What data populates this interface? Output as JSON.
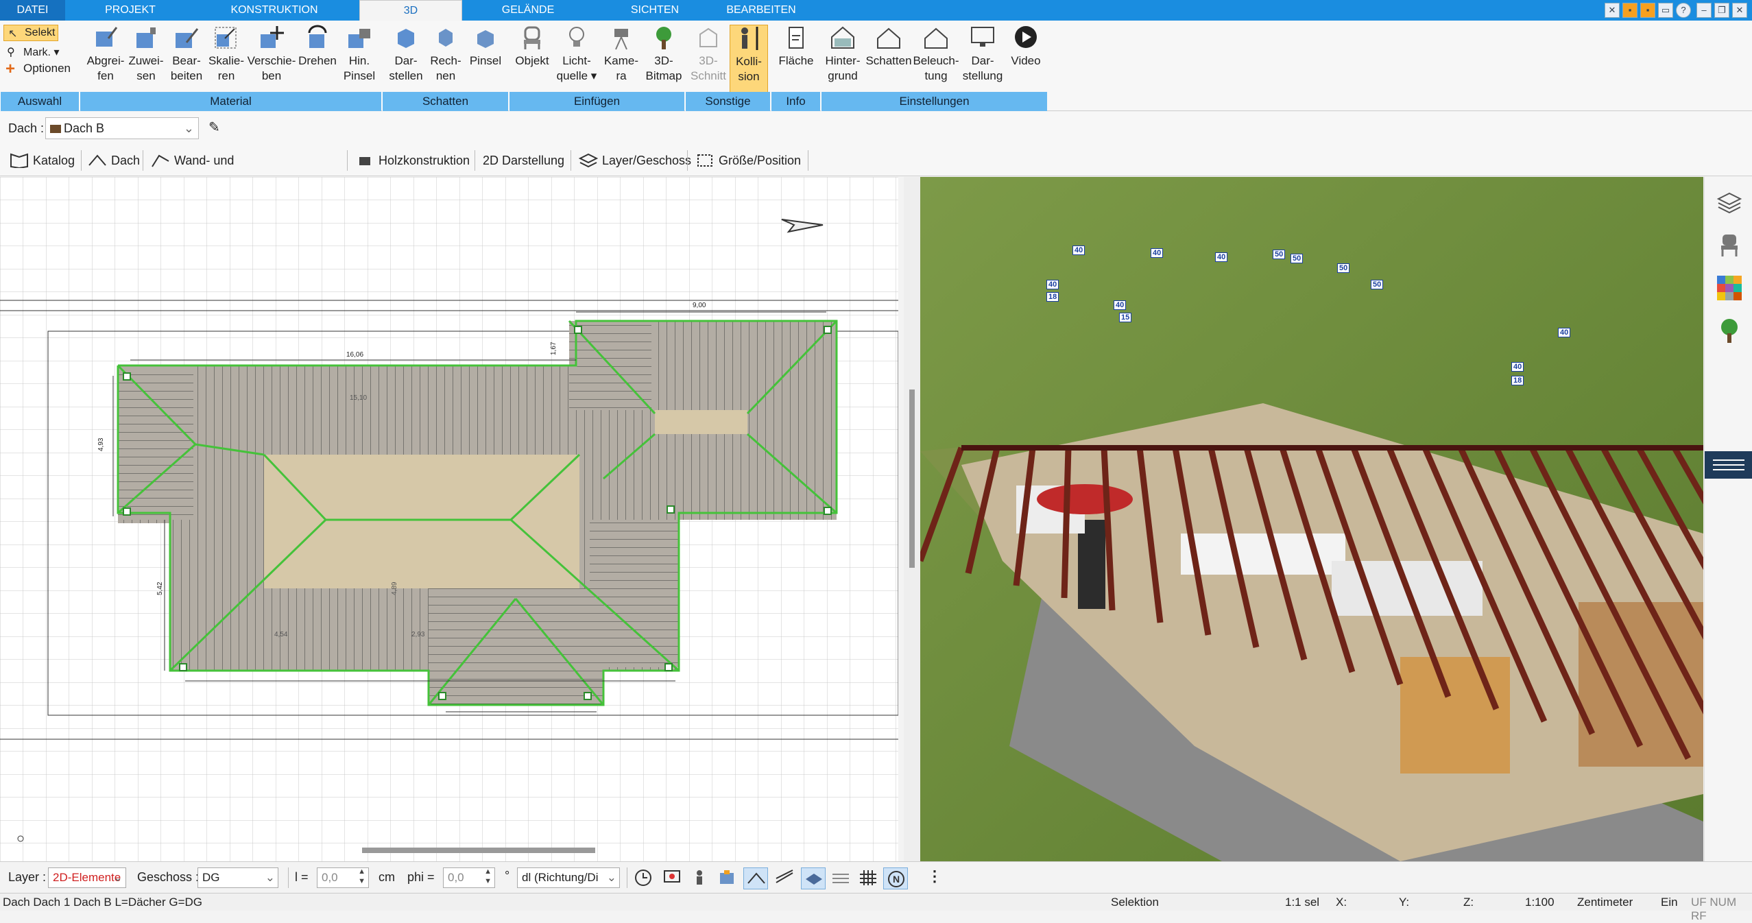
{
  "menu": {
    "tabs": [
      "DATEI",
      "PROJEKT",
      "KONSTRUKTION",
      "3D",
      "GELÄNDE",
      "SICHTEN",
      "BEARBEITEN"
    ],
    "active": "3D"
  },
  "ribbon": {
    "auswahl": {
      "selekt": "Selekt",
      "mark": "Mark.",
      "optionen": "Optionen",
      "group": "Auswahl"
    },
    "material": {
      "group": "Material",
      "buttons": [
        [
          "Abgrei-",
          "fen"
        ],
        [
          "Zuwei-",
          "sen"
        ],
        [
          "Bear-",
          "beiten"
        ],
        [
          "Skalie-",
          "ren"
        ],
        [
          "Verschie-",
          "ben"
        ],
        [
          "Drehen",
          ""
        ],
        [
          "Hin.",
          "Pinsel"
        ]
      ]
    },
    "schatten": {
      "group": "Schatten",
      "buttons": [
        [
          "Dar-",
          "stellen"
        ],
        [
          "Rech-",
          "nen"
        ],
        [
          "Pinsel",
          ""
        ]
      ]
    },
    "einfuegen": {
      "group": "Einfügen",
      "buttons": [
        [
          "Objekt",
          ""
        ],
        [
          "Licht-",
          "quelle"
        ],
        [
          "Kame-",
          "ra"
        ],
        [
          "3D-",
          "Bitmap"
        ]
      ]
    },
    "sonstige": {
      "group": "Sonstige",
      "buttons": [
        [
          "3D-",
          "Schnitt"
        ],
        [
          "Kolli-",
          "sion"
        ]
      ]
    },
    "info": {
      "group": "Info",
      "buttons": [
        [
          "Fläche",
          ""
        ]
      ]
    },
    "einstellungen": {
      "group": "Einstellungen",
      "buttons": [
        [
          "Hinter-",
          "grund"
        ],
        [
          "Schatten",
          ""
        ],
        [
          "Beleuch-",
          "tung"
        ],
        [
          "Dar-",
          "stellung"
        ],
        [
          "Video",
          ""
        ]
      ]
    }
  },
  "dach_select": {
    "label": "Dach :",
    "value": "Dach B"
  },
  "toolbar": [
    "Katalog",
    "Dach",
    "Wand- und Dachverschneidung",
    "Holzkonstruktion",
    "2D Darstellung",
    "Layer/Geschoss",
    "Größe/Position"
  ],
  "plan": {
    "dims": {
      "top": "9,00",
      "length": "16,06",
      "left": "4,93",
      "left2": "5,42",
      "a": "1,67",
      "b": "15,10",
      "c": "4,54",
      "d": "2,93",
      "e": "4,89"
    },
    "labels_3d": [
      "40",
      "40",
      "40",
      "50",
      "50",
      "50",
      "50",
      "40",
      "40",
      "18",
      "40",
      "15",
      "40",
      "18",
      "50"
    ]
  },
  "bottom": {
    "layer_label": "Layer :",
    "layer_value": "2D-Elemente",
    "geschoss_label": "Geschoss :",
    "geschoss_value": "DG",
    "l_label": "l =",
    "l_value": "0,0",
    "unit": "cm",
    "phi_label": "phi =",
    "phi_value": "0,0",
    "deg": "°",
    "dl_value": "dl (Richtung/Di"
  },
  "status": {
    "left": "Dach Dach 1 Dach B L=Dächer G=DG",
    "mode": "Selektion",
    "scale1": "1:1 sel",
    "x": "X:",
    "y": "Y:",
    "z": "Z:",
    "scale2": "1:100",
    "unit": "Zentimeter",
    "ein": "Ein",
    "flags": "UF NUM RF"
  },
  "colors": {
    "accent": "#1a8de0",
    "group": "#66b8f0",
    "selected": "#fdd77a",
    "roof": "#c9c3b8",
    "ridge": "#45c23a",
    "grass": "#6b8f38",
    "rafter": "#6e2418"
  }
}
